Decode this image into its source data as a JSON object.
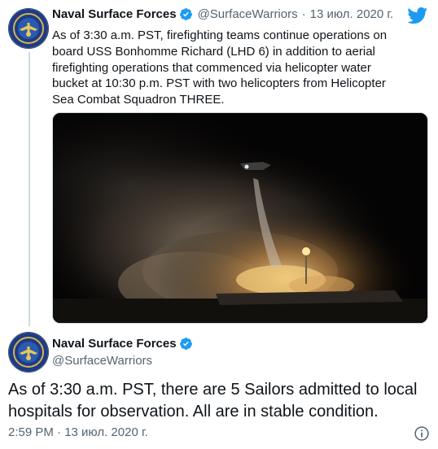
{
  "tweet1": {
    "display_name": "Naval Surface Forces",
    "handle": "@SurfaceWarriors",
    "separator": "·",
    "date": "13 июл. 2020 г.",
    "text": "As of 3:30 a.m. PST, firefighting teams continue operations on board USS Bonhomme Richard (LHD 6) in addition to aerial firefighting operations that commenced via helicopter water bucket at 10:30 p.m. PST with two helicopters from Helicopter Sea Combat Squadron THREE."
  },
  "tweet2": {
    "display_name": "Naval Surface Forces",
    "handle": "@SurfaceWarriors",
    "text": "As of 3:30 a.m. PST, there are 5 Sailors admitted to local hospitals for observation. All are in stable condition.",
    "timestamp": "2:59 PM · 13 июл. 2020 г."
  },
  "icons": {
    "brand": "twitter-bird-icon",
    "verified": "verified-badge-icon",
    "info": "info-icon"
  },
  "colors": {
    "twitter_blue": "#1d9bf0",
    "secondary_text": "#536471",
    "thread_line": "#cfd9de"
  }
}
